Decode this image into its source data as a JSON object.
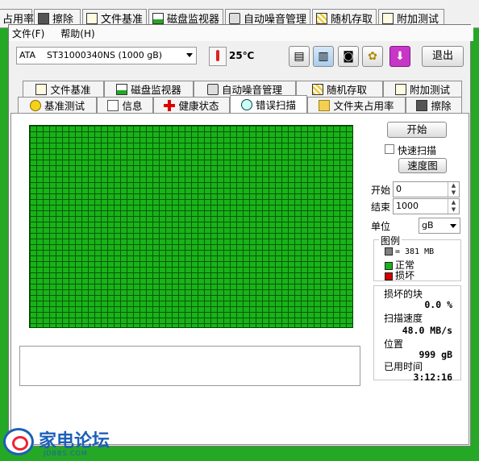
{
  "background_tabs": [
    "占用率",
    "擦除",
    "文件基准",
    "磁盘监视器",
    "自动噪音管理",
    "随机存取",
    "附加测试"
  ],
  "menu": {
    "file": "文件(F)",
    "help": "帮助(H)"
  },
  "drive_select": {
    "value": "ATA    ST31000340NS (1000 gB)"
  },
  "temperature": "25℃",
  "exit_label": "退出",
  "tabs_row1": [
    "文件基准",
    "磁盘监视器",
    "自动噪音管理",
    "随机存取",
    "附加测试"
  ],
  "tabs_row2": [
    "基准测试",
    "信息",
    "健康状态",
    "错误扫描",
    "文件夹占用率",
    "擦除"
  ],
  "active_tab": "错误扫描",
  "controls": {
    "start_button": "开始",
    "quick_scan_label": "快速扫描",
    "quick_scan_checked": false,
    "speed_map_button": "速度图",
    "start_label": "开始",
    "start_value": "0",
    "end_label": "结束",
    "end_value": "1000",
    "unit_label": "单位",
    "unit_value": "gB"
  },
  "legend": {
    "title": "图例",
    "block_size": "= 381 MB",
    "normal": "正常",
    "damaged": "损坏",
    "colors": {
      "block": "#808080",
      "normal": "#19b319",
      "damaged": "#d40000"
    }
  },
  "stats": {
    "bad_blocks_label": "损坏的块",
    "bad_blocks_value": "0.0 %",
    "scan_speed_label": "扫描速度",
    "scan_speed_value": "48.0 MB/s",
    "position_label": "位置",
    "position_value": "999 gB",
    "elapsed_label": "已用时间",
    "elapsed_value": "3:12:16"
  },
  "watermark": {
    "text": "家电论坛",
    "sub": "JDBBS.COM"
  },
  "colors": {
    "scan_green": "#19b319",
    "grid_line": "#085a08",
    "desktop_green": "#25a825"
  }
}
